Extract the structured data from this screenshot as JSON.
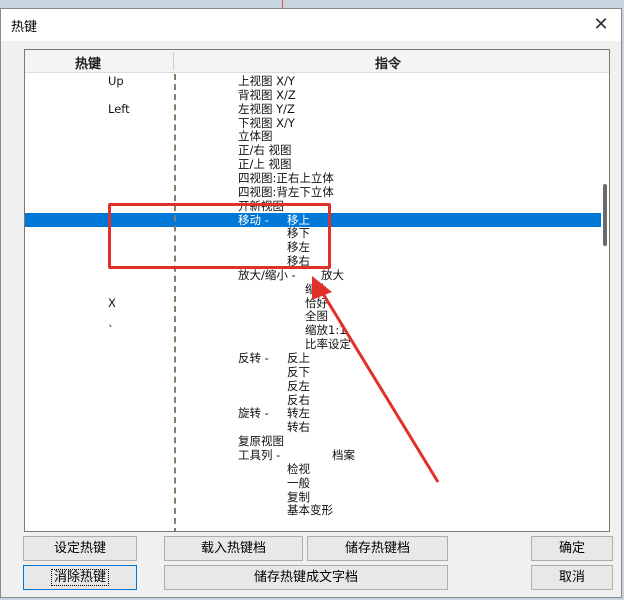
{
  "dialog": {
    "title": "热键",
    "close_label": "✕"
  },
  "list": {
    "header_hotkey": "热键",
    "header_command": "指令",
    "rows": [
      {
        "hotkey": "Up",
        "segments": [
          {
            "text": "上视图 X/Y",
            "indent": 0
          }
        ]
      },
      {
        "hotkey": "",
        "segments": [
          {
            "text": "背视图 X/Z",
            "indent": 0
          }
        ]
      },
      {
        "hotkey": "Left",
        "segments": [
          {
            "text": "左视图 Y/Z",
            "indent": 0
          }
        ]
      },
      {
        "hotkey": "",
        "segments": [
          {
            "text": "下视图 X/Y",
            "indent": 0
          }
        ]
      },
      {
        "hotkey": "",
        "segments": [
          {
            "text": "立体图",
            "indent": 0
          }
        ]
      },
      {
        "hotkey": "",
        "segments": [
          {
            "text": "正/右 视图",
            "indent": 0
          }
        ]
      },
      {
        "hotkey": "",
        "segments": [
          {
            "text": "正/上 视图",
            "indent": 0
          }
        ]
      },
      {
        "hotkey": "",
        "segments": [
          {
            "text": "四视图:正右上立体",
            "indent": 0
          }
        ]
      },
      {
        "hotkey": "",
        "segments": [
          {
            "text": "四视图:背左下立体",
            "indent": 0
          }
        ]
      },
      {
        "hotkey": "",
        "segments": [
          {
            "text": "开新视图",
            "indent": 0
          }
        ]
      },
      {
        "hotkey": "",
        "segments": [
          {
            "text": "移动 -",
            "indent": 0
          },
          {
            "text": "移上",
            "indent": 1
          }
        ],
        "selected": true
      },
      {
        "hotkey": "",
        "segments": [
          {
            "text": "移下",
            "indent": 1
          }
        ]
      },
      {
        "hotkey": "",
        "segments": [
          {
            "text": "移左",
            "indent": 1
          }
        ]
      },
      {
        "hotkey": "",
        "segments": [
          {
            "text": "移右",
            "indent": 1
          }
        ]
      },
      {
        "hotkey": "",
        "segments": [
          {
            "text": "放大/缩小 -",
            "indent": 0
          },
          {
            "text": "放大",
            "indent": 2
          }
        ]
      },
      {
        "hotkey": "",
        "segments": [
          {
            "text": "缩小",
            "indent": 3
          }
        ]
      },
      {
        "hotkey": "X",
        "segments": [
          {
            "text": "恰好",
            "indent": 3
          }
        ]
      },
      {
        "hotkey": "",
        "segments": [
          {
            "text": "全图",
            "indent": 3
          }
        ]
      },
      {
        "hotkey": "`",
        "segments": [
          {
            "text": "缩放1:1",
            "indent": 3
          }
        ]
      },
      {
        "hotkey": "",
        "segments": [
          {
            "text": "比率设定",
            "indent": 3
          }
        ]
      },
      {
        "hotkey": "",
        "segments": [
          {
            "text": "反转 -",
            "indent": 0
          },
          {
            "text": "反上",
            "indent": 1
          }
        ]
      },
      {
        "hotkey": "",
        "segments": [
          {
            "text": "反下",
            "indent": 1
          }
        ]
      },
      {
        "hotkey": "",
        "segments": [
          {
            "text": "反左",
            "indent": 1
          }
        ]
      },
      {
        "hotkey": "",
        "segments": [
          {
            "text": "反右",
            "indent": 1
          }
        ]
      },
      {
        "hotkey": "",
        "segments": [
          {
            "text": "旋转 -",
            "indent": 0
          },
          {
            "text": "转左",
            "indent": 1
          }
        ]
      },
      {
        "hotkey": "",
        "segments": [
          {
            "text": "转右",
            "indent": 1
          }
        ]
      },
      {
        "hotkey": "",
        "segments": [
          {
            "text": "复原视图",
            "indent": 0
          }
        ]
      },
      {
        "hotkey": "",
        "segments": [
          {
            "text": "工具列 -",
            "indent": 0
          },
          {
            "text": "档案",
            "indent": 4
          }
        ]
      },
      {
        "hotkey": "",
        "segments": [
          {
            "text": "检视",
            "indent": 1
          }
        ]
      },
      {
        "hotkey": "",
        "segments": [
          {
            "text": "一般",
            "indent": 1
          }
        ]
      },
      {
        "hotkey": "",
        "segments": [
          {
            "text": "复制",
            "indent": 1
          }
        ]
      },
      {
        "hotkey": "",
        "segments": [
          {
            "text": "基本变形",
            "indent": 1
          }
        ]
      }
    ]
  },
  "buttons": {
    "set_hotkey": "设定热键",
    "clear_hotkey": "消除热键",
    "load_file": "载入热键档",
    "save_file": "储存热键档",
    "save_text": "储存热键成文字档",
    "ok": "确定",
    "cancel": "取消"
  },
  "annotation_color": "#e0302a",
  "selection_color": "#0078d7"
}
